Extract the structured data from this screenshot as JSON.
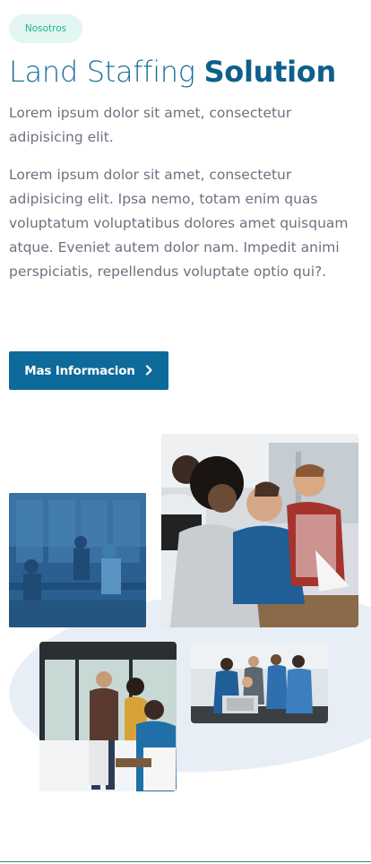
{
  "section": {
    "badge": "Nosotros",
    "title_light": "Land Staffing",
    "title_bold": "Solution",
    "paragraph_1": "Lorem ipsum dolor sit amet, consectetur adipisicing elit.",
    "paragraph_2": "Lorem ipsum dolor sit amet, consectetur adipisicing elit. Ipsa nemo, totam enim quas voluptatum voluptatibus dolores amet quisquam atque. Eveniet autem dolor nam. Impedit animi perspiciatis, repellendus voluptate optio qui?.",
    "cta_label": "Mas Informacion"
  },
  "colors": {
    "brand_blue": "#0e6a9a",
    "badge_bg": "#e3f6f1",
    "badge_text": "#1fb391",
    "blob": "#e7eef5"
  },
  "icons": {
    "cta_icon": "chevron-right-icon"
  }
}
